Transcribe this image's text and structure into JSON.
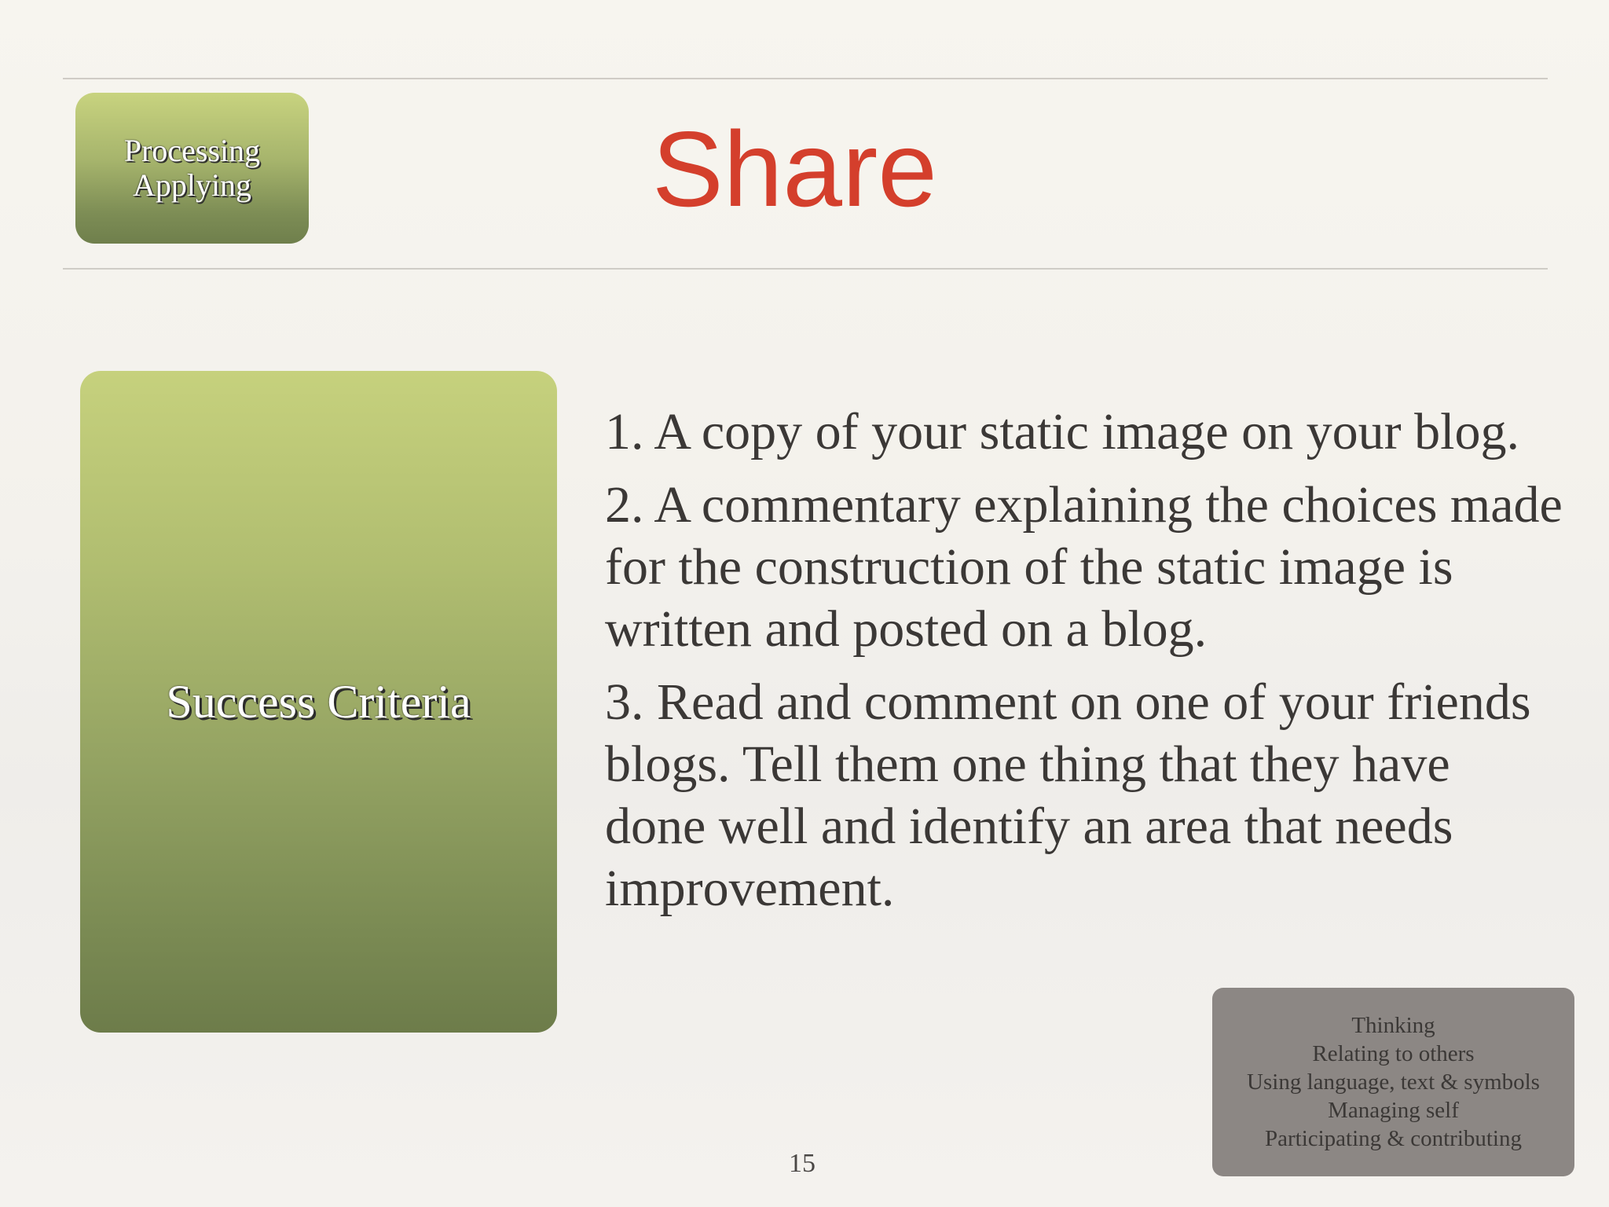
{
  "tag": {
    "line1": "Processing",
    "line2": "Applying"
  },
  "title": "Share",
  "criteria_panel": {
    "label": "Success Criteria"
  },
  "criteria": [
    "1. A copy of your static image on your blog.",
    "2. A commentary explaining the choices made for the construction of the static image is written and posted on a blog.",
    "3. Read and comment on one of your friends blogs. Tell them one thing that they have done well and identify an area that needs improvement."
  ],
  "competencies": [
    "Thinking",
    "Relating to others",
    "Using language, text & symbols",
    "Managing self",
    "Participating & contributing"
  ],
  "page_number": "15",
  "colors": {
    "title": "#d43f2c",
    "panel_top": "#c6d17d",
    "panel_bottom": "#6d7c4a",
    "competency_box": "#8c8784",
    "body_text": "#3b3836"
  }
}
